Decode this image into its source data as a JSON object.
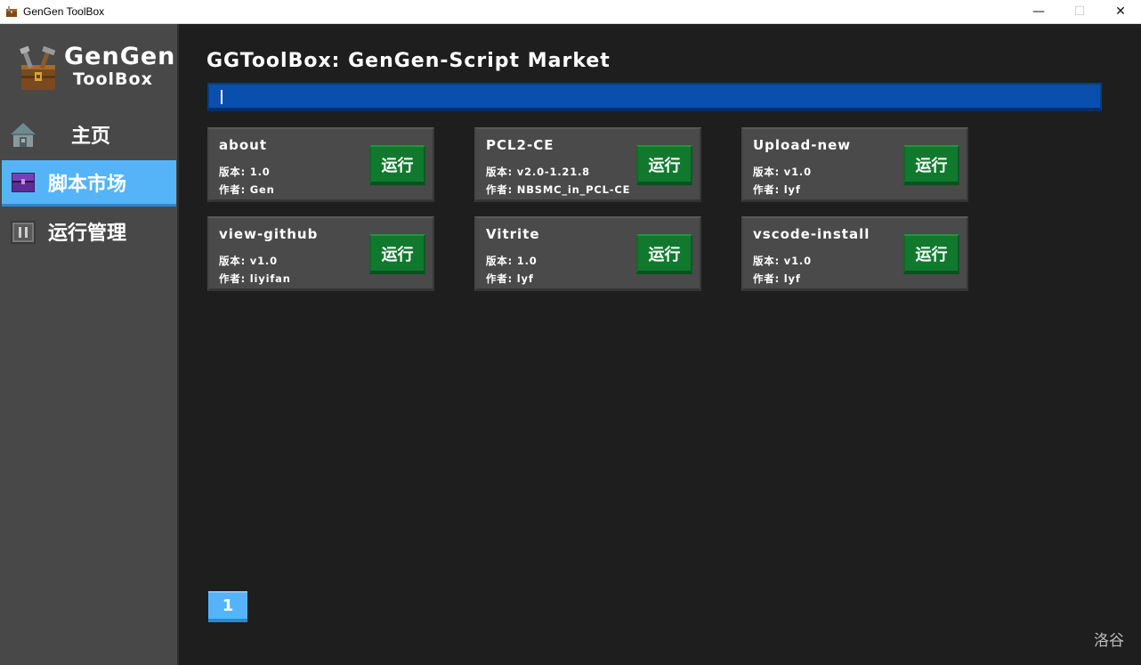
{
  "window": {
    "title": "GenGen ToolBox",
    "controls": {
      "minimize": "—",
      "maximize": "☐",
      "close": "✕"
    }
  },
  "sidebar": {
    "brand_title": "GenGen",
    "brand_subtitle": "ToolBox",
    "items": [
      {
        "label": "主页",
        "icon": "house-icon",
        "active": false
      },
      {
        "label": "脚本市场",
        "icon": "purple-chest-icon",
        "active": true
      },
      {
        "label": "运行管理",
        "icon": "pause-block-icon",
        "active": false
      }
    ]
  },
  "main": {
    "page_title": "GGToolBox: GenGen-Script Market",
    "search": {
      "value": "",
      "placeholder": ""
    },
    "run_label": "运行",
    "scripts": [
      {
        "name": "about",
        "version": "版本: 1.0",
        "author": "作者: Gen"
      },
      {
        "name": "PCL2-CE",
        "version": "版本: v2.0-1.21.8",
        "author": "作者: NBSMC_in_PCL-CE"
      },
      {
        "name": "Upload-new",
        "version": "版本: v1.0",
        "author": "作者: lyf"
      },
      {
        "name": "view-github",
        "version": "版本: v1.0",
        "author": "作者: liyifan"
      },
      {
        "name": "Vitrite",
        "version": "版本: 1.0",
        "author": "作者: lyf"
      },
      {
        "name": "vscode-install",
        "version": "版本: v1.0",
        "author": "作者: lyf"
      }
    ],
    "pagination": {
      "current": "1"
    },
    "watermark": "洛谷"
  },
  "colors": {
    "background": "#1e1e1e",
    "sidebar": "#484848",
    "active_nav": "#55b4f8",
    "search_bar": "#0a4fad",
    "card": "#4a4a4a",
    "run_button": "#11792e"
  }
}
